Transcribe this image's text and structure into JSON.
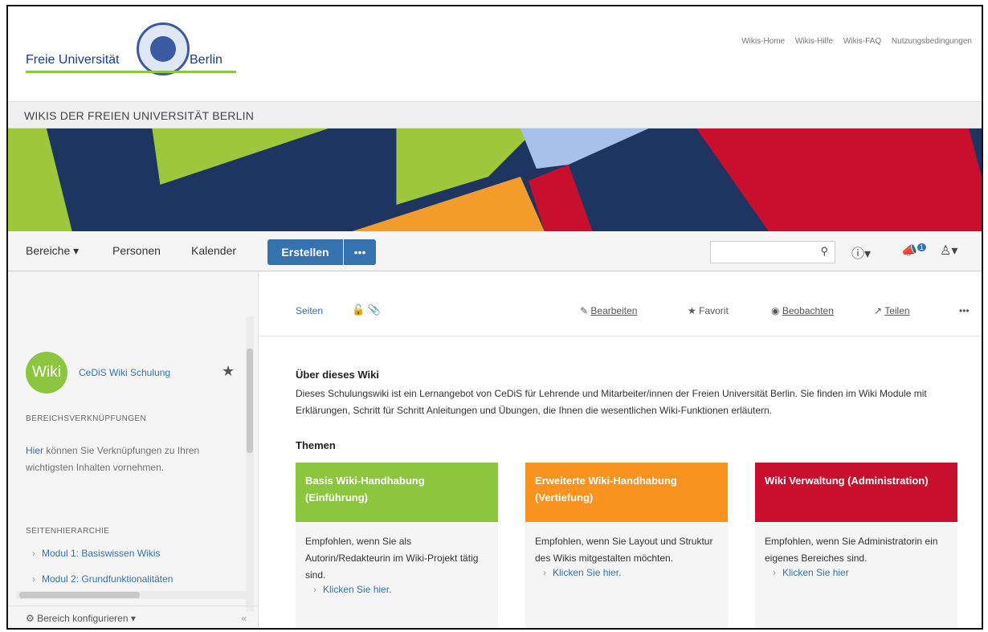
{
  "header": {
    "logo_left": "Freie Universität",
    "logo_right": "Berlin",
    "links": [
      "Wikis-Home",
      "Wikis-Hilfe",
      "Wikis-FAQ",
      "Nutzungsbedingungen"
    ]
  },
  "site_title": "WIKIS DER FREIEN UNIVERSITÄT BERLIN",
  "colors": {
    "fu_blue": "#1a3d8f",
    "fu_green": "#8cc63f",
    "banner_navy": "#1e3561",
    "banner_green": "#9fc73b",
    "banner_orange": "#f39c2c",
    "banner_red": "#c8102e",
    "banner_light_blue": "#a8c1e8",
    "confluence_blue": "#3572b0",
    "card_green": "#8cc63f",
    "card_orange": "#f7931e",
    "card_red": "#c8102e"
  },
  "nav": {
    "items": [
      "Bereiche",
      "Personen",
      "Kalender"
    ],
    "create_label": "Erstellen",
    "more_label": "•••",
    "search_icon": "search-icon",
    "help_icon": "help-icon",
    "notifications_icon": "notifications-icon",
    "notifications_count": "1",
    "avatar_icon": "user-avatar-icon"
  },
  "sidebar": {
    "logo_text": "Wiki",
    "space_name": "CeDiS Wiki Schulung",
    "links_heading": "BEREICHSVERKNÜPFUNGEN",
    "links_text_link": "Hier",
    "links_text_rest": " können Sie Verknüpfungen zu Ihren wichtigsten Inhalten vornehmen.",
    "hierarchy_heading": "SEITENHIERARCHIE",
    "tree": [
      "Modul 1: Basiswissen Wikis",
      "Modul 2: Grundfunktionalitäten"
    ],
    "configure_label": "Bereich konfigurieren",
    "collapse_label": "«"
  },
  "page": {
    "breadcrumb": "Seiten",
    "actions": {
      "edit": "Bearbeiten",
      "favorite": "Favorit",
      "watch": "Beobachten",
      "share": "Teilen",
      "more": "•••"
    },
    "heading": "Über dieses Wiki",
    "intro": "Dieses Schulungswiki ist ein Lernangebot von CeDiS für Lehrende und Mitarbeiter/innen der Freien Universität Berlin. Sie finden im Wiki Module mit Erklärungen, Schritt für Schritt Anleitungen und Übungen, die Ihnen die wesentlichen Wiki-Funktionen erläutern.",
    "themen": "Themen",
    "cards": [
      {
        "title": "Basis Wiki-Handhabung (Einführung)",
        "text": "Empfohlen, wenn Sie als Autorin/Redakteurin im Wiki-Projekt tätig sind.",
        "link": "Klicken Sie hier."
      },
      {
        "title": "Erweiterte Wiki-Handhabung (Vertiefung)",
        "text": "Empfohlen, wenn Sie Layout und Struktur des Wikis mitgestalten möchten.",
        "link": "Klicken Sie hier."
      },
      {
        "title": "Wiki Verwaltung (Administration)",
        "text": "Empfohlen, wenn Sie Administratorin ein eigenes Bereiches sind.",
        "link": "Klicken Sie hier"
      }
    ]
  }
}
